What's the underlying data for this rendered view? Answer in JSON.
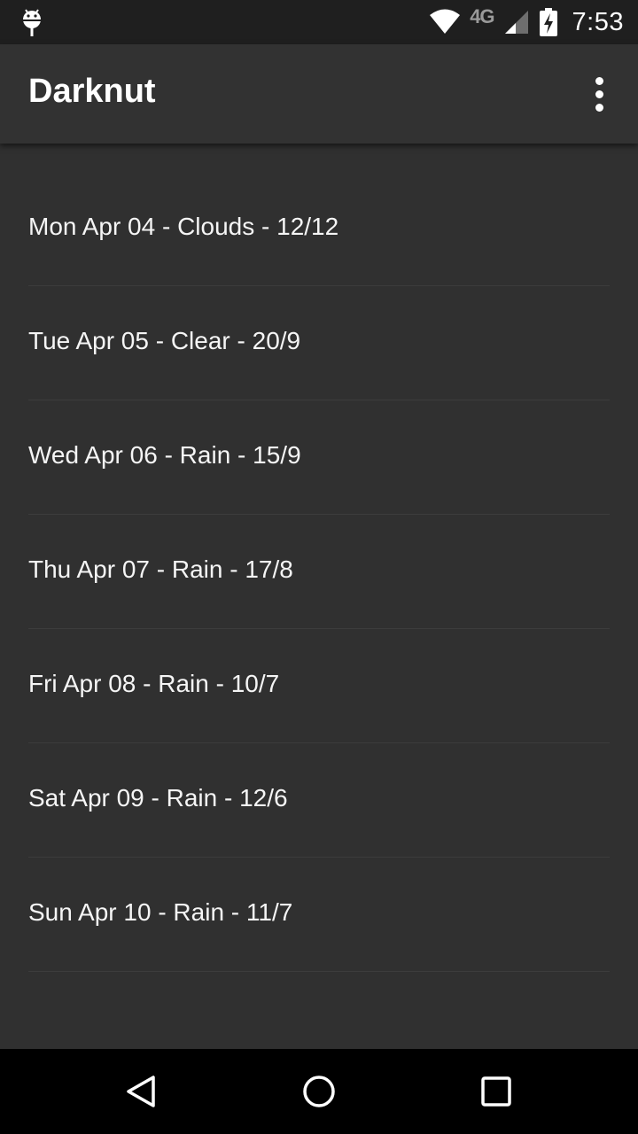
{
  "status_bar": {
    "time": "7:53",
    "network": "4G",
    "icons": [
      "android-debug-icon",
      "wifi-icon",
      "lte-icon",
      "cell-signal-icon",
      "battery-charging-icon"
    ]
  },
  "app_bar": {
    "title": "Darknut",
    "menu_icon": "overflow-menu-icon"
  },
  "forecast": [
    {
      "label": "Mon Apr 04 - Clouds - 12/12"
    },
    {
      "label": "Tue Apr 05 - Clear - 20/9"
    },
    {
      "label": "Wed Apr 06 - Rain - 15/9"
    },
    {
      "label": "Thu Apr 07 - Rain - 17/8"
    },
    {
      "label": "Fri Apr 08 - Rain - 10/7"
    },
    {
      "label": "Sat Apr 09 - Rain - 12/6"
    },
    {
      "label": "Sun Apr 10 - Rain - 11/7"
    }
  ],
  "nav_bar": {
    "icons": [
      "back-icon",
      "home-icon",
      "recents-icon"
    ]
  },
  "colors": {
    "background": "#303030",
    "app_bar": "#323232",
    "status_bar": "#1f1f1f",
    "nav_bar": "#000000",
    "text": "#f5f5f5",
    "divider": "#3c3c3c"
  }
}
